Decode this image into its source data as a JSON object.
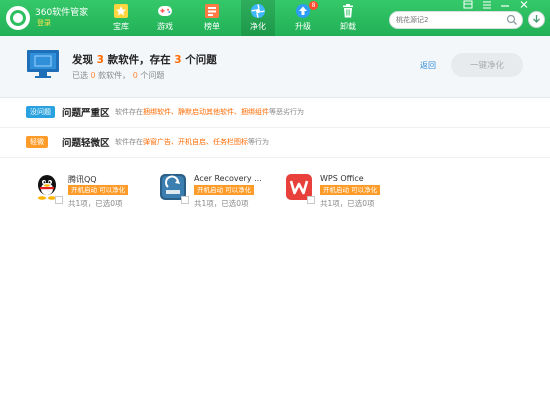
{
  "app": {
    "title": "360软件管家",
    "login": "登录"
  },
  "nav": [
    {
      "label": "宝库",
      "icon": "star-icon"
    },
    {
      "label": "游戏",
      "icon": "gamepad-icon"
    },
    {
      "label": "榜单",
      "icon": "ranking-icon"
    },
    {
      "label": "净化",
      "icon": "purify-icon",
      "active": true
    },
    {
      "label": "升级",
      "icon": "upgrade-icon",
      "badge": "8"
    },
    {
      "label": "卸载",
      "icon": "trash-icon"
    }
  ],
  "search": {
    "placeholder": "桃花源记2"
  },
  "summary": {
    "title_prefix": "发现 ",
    "software_count": "3",
    "title_middle": " 款软件，存在 ",
    "problem_count": "3",
    "title_suffix": " 个问题",
    "sub_prefix": "已选 ",
    "selected_software": "0",
    "sub_middle": " 款软件，  ",
    "selected_problems": "0",
    "sub_suffix": " 个问题",
    "back_label": "返回",
    "clean_label": "一键净化"
  },
  "sections": {
    "serious": {
      "tag": "没问题",
      "title": "问题严重区",
      "desc_prefix": "软件存在",
      "desc_hl": "捆绑软件、静默启动其他软件、捆绑组件",
      "desc_suffix": "等恶劣行为"
    },
    "minor": {
      "tag": "轻微",
      "title": "问题轻微区",
      "desc_prefix": "软件存在",
      "desc_hl": "弹窗广告、开机自启、任务栏图标",
      "desc_suffix": "等行为"
    }
  },
  "software": [
    {
      "name": "腾讯QQ",
      "tag": "开机启动 可以净化",
      "count": "共1项，已选0项",
      "icon": "qq-penguin-icon"
    },
    {
      "name": "Acer Recovery ...",
      "tag": "开机启动 可以净化",
      "count": "共1项，已选0项",
      "icon": "acer-recovery-icon"
    },
    {
      "name": "WPS Office",
      "tag": "开机启动 可以净化",
      "count": "共1项，已选0项",
      "icon": "wps-icon"
    }
  ],
  "colors": {
    "topbar": "#2fbf60",
    "accent_orange": "#ff6a00",
    "tag_orange": "#ff9c29",
    "tag_blue": "#2aa2e0",
    "link_blue": "#2a8bd8"
  }
}
